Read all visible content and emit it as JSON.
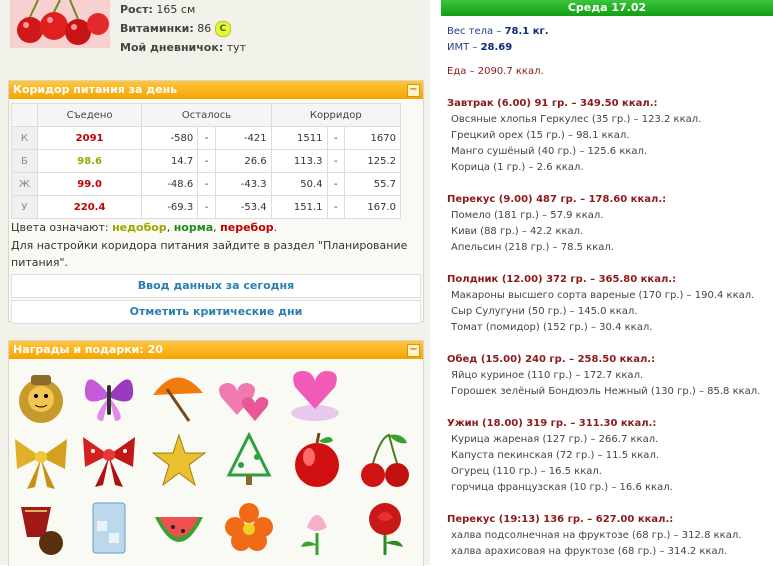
{
  "profile": {
    "height_label": "Рост:",
    "height_value": "165 см",
    "vitamins_label": "Витаминки:",
    "vitamins_value": "86",
    "vitamins_badge": "C",
    "diary_label": "Мой дневничок:",
    "diary_value": "тут"
  },
  "corridor": {
    "title": "Коридор питания за день",
    "collapse": "−",
    "headers": [
      "Съедено",
      "Осталось",
      "Корридор"
    ],
    "rows": [
      {
        "label": "К",
        "eaten": "2091",
        "eaten_color": "#c00000",
        "rem_min": "-580",
        "rem_max": "-421",
        "cor_min": "1511",
        "cor_max": "1670"
      },
      {
        "label": "Б",
        "eaten": "98.6",
        "eaten_color": "#99a800",
        "rem_min": "14.7",
        "rem_max": "26.6",
        "cor_min": "113.3",
        "cor_max": "125.2"
      },
      {
        "label": "Ж",
        "eaten": "99.0",
        "eaten_color": "#c00000",
        "rem_min": "-48.6",
        "rem_max": "-43.3",
        "cor_min": "50.4",
        "cor_max": "55.7"
      },
      {
        "label": "У",
        "eaten": "220.4",
        "eaten_color": "#c00000",
        "rem_min": "-69.3",
        "rem_max": "-53.4",
        "cor_min": "151.1",
        "cor_max": "167.0"
      }
    ],
    "dash": "-",
    "legend_prefix": "Цвета означают:",
    "legend_under": "недобор",
    "legend_norm": "норма",
    "legend_over": "перебор",
    "legend_sep": ",",
    "legend_end": ".",
    "hint": "Для настройки коридора питания зайдите в раздел \"Планирование питания\".",
    "link_today": "Ввод данных за сегодня",
    "link_critical": "Отметить критические дни",
    "colors": {
      "under": "#99a800",
      "norm": "#1e8c1e",
      "over": "#c00000"
    }
  },
  "awards": {
    "title": "Награды и подарки: 20",
    "collapse": "−",
    "items": [
      "lion-icon",
      "butterfly-icon",
      "umbrella-icon",
      "hearts-icon",
      "heart-cloud-icon",
      "bow-gold-icon",
      "bow-red-icon",
      "star-icon",
      "christmas-tree-icon",
      "apple-icon",
      "cherries-icon",
      "candy-icon",
      "glass-icon",
      "watermelon-icon",
      "flower-icon",
      "tulip-icon",
      "rose-icon"
    ]
  },
  "day": {
    "title": "Среда 17.02",
    "weight_label": "Вес тела –",
    "weight_value": "78.1 кг.",
    "bmi_label": "ИМТ –",
    "bmi_value": "28.69",
    "food_total": "Еда – 2090.7 ккал.",
    "meals": [
      {
        "title": "Завтрак (6.00) 91 гр. – 349.50 ккал.:",
        "items": [
          "Овсяные хлопья Геркулес (35 гр.) – 123.2 ккал.",
          "Грецкий орех (15 гр.) – 98.1 ккал.",
          "Манго сушёный (40 гр.) – 125.6 ккал.",
          "Корица (1 гр.) – 2.6 ккал."
        ]
      },
      {
        "title": "Перекус (9.00) 487 гр. – 178.60 ккал.:",
        "items": [
          "Помело (181 гр.) – 57.9 ккал.",
          "Киви (88 гр.) – 42.2 ккал.",
          "Апельсин (218 гр.) – 78.5 ккал."
        ]
      },
      {
        "title": "Полдник (12.00) 372 гр. – 365.80 ккал.:",
        "items": [
          "Макароны высшего сорта вареные (170 гр.) – 190.4 ккал.",
          "Сыр Сулугуни (50 гр.) – 145.0 ккал.",
          "Томат (помидор) (152 гр.) – 30.4 ккал."
        ]
      },
      {
        "title": "Обед (15.00) 240 гр. – 258.50 ккал.:",
        "items": [
          "Яйцо куриное (110 гр.) – 172.7 ккал.",
          "Горошек зелёный Бондюэль Нежный (130 гр.) – 85.8 ккал."
        ]
      },
      {
        "title": "Ужин (18.00) 319 гр. – 311.30 ккал.:",
        "items": [
          "Курица жареная (127 гр.) – 266.7 ккал.",
          "Капуста пекинская (72 гр.) – 11.5 ккал.",
          "Огурец (110 гр.) – 16.5 ккал.",
          "горчица французская (10 гр.) – 16.6 ккал."
        ]
      },
      {
        "title": "Перекус (19:13) 136 гр. – 627.00 ккал.:",
        "items": [
          "халва подсолнечная на фруктозе (68 гр.) – 312.8 ккал.",
          "халва арахисовая на фруктозе (68 гр.) – 314.2 ккал."
        ]
      }
    ]
  }
}
